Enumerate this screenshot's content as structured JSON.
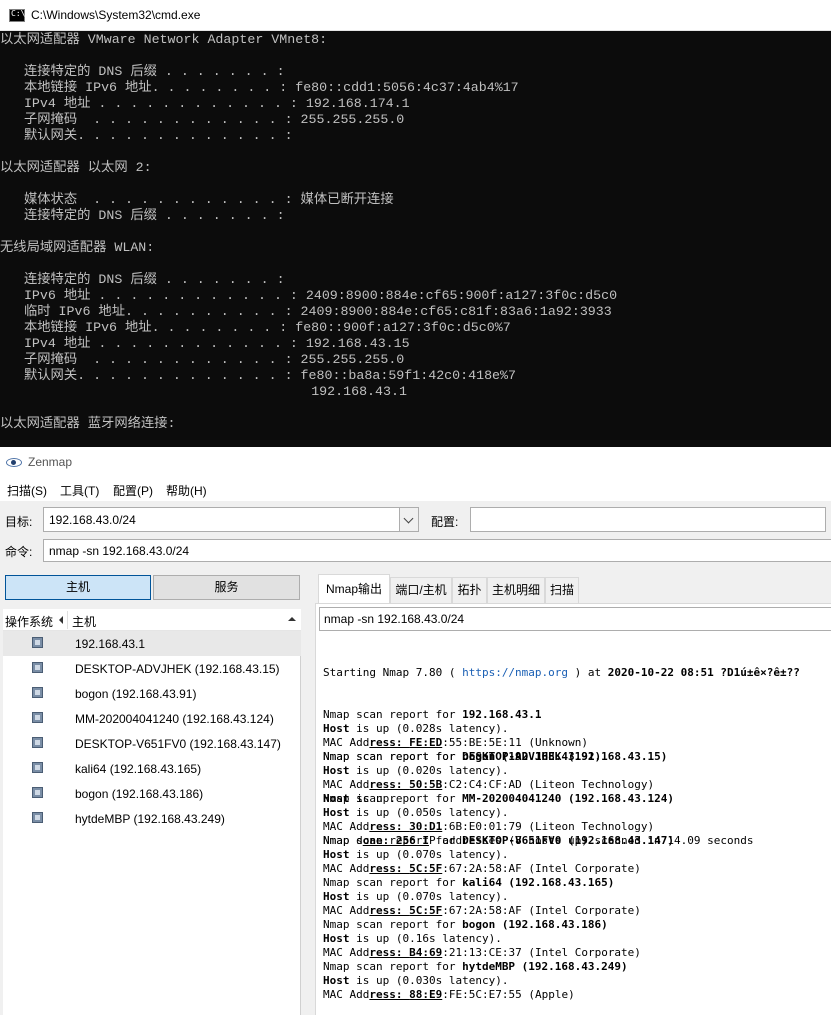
{
  "cmd": {
    "title": "C:\\Windows\\System32\\cmd.exe",
    "lines": [
      "以太网适配器 VMware Network Adapter VMnet8:",
      "",
      "   连接特定的 DNS 后缀 . . . . . . . :",
      "   本地链接 IPv6 地址. . . . . . . . : fe80::cdd1:5056:4c37:4ab4%17",
      "   IPv4 地址 . . . . . . . . . . . . : 192.168.174.1",
      "   子网掩码  . . . . . . . . . . . . : 255.255.255.0",
      "   默认网关. . . . . . . . . . . . . :",
      "",
      "以太网适配器 以太网 2:",
      "",
      "   媒体状态  . . . . . . . . . . . . : 媒体已断开连接",
      "   连接特定的 DNS 后缀 . . . . . . . :",
      "",
      "无线局域网适配器 WLAN:",
      "",
      "   连接特定的 DNS 后缀 . . . . . . . :",
      "   IPv6 地址 . . . . . . . . . . . . : 2409:8900:884e:cf65:900f:a127:3f0c:d5c0",
      "   临时 IPv6 地址. . . . . . . . . . : 2409:8900:884e:cf65:c81f:83a6:1a92:3933",
      "   本地链接 IPv6 地址. . . . . . . . : fe80::900f:a127:3f0c:d5c0%7",
      "   IPv4 地址 . . . . . . . . . . . . : 192.168.43.15",
      "   子网掩码  . . . . . . . . . . . . : 255.255.255.0",
      "   默认网关. . . . . . . . . . . . . : fe80::ba8a:59f1:42c0:418e%7",
      "                                       192.168.43.1",
      "",
      "以太网适配器 蓝牙网络连接:"
    ]
  },
  "zenmap": {
    "title": "Zenmap",
    "menu": [
      "扫描(S)",
      "工具(T)",
      "配置(P)",
      "帮助(H)"
    ],
    "target_label": "目标:",
    "target_value": "192.168.43.0/24",
    "profile_label": "配置:",
    "profile_value": "",
    "command_label": "命令:",
    "command_value": "nmap -sn 192.168.43.0/24",
    "left_buttons": {
      "hosts": "主机",
      "services": "服务"
    },
    "host_columns": {
      "os": "操作系统",
      "host": "主机"
    },
    "hosts": [
      "192.168.43.1",
      "DESKTOP-ADVJHEK (192.168.43.15)",
      "bogon (192.168.43.91)",
      "MM-202004041240 (192.168.43.124)",
      "DESKTOP-V651FV0 (192.168.43.147)",
      "kali64 (192.168.43.165)",
      "bogon (192.168.43.186)",
      "hytdeMBP (192.168.43.249)"
    ],
    "tabs": [
      "Nmap输出",
      "端口/主机",
      "拓扑",
      "主机明细",
      "扫描"
    ],
    "output_command": "nmap -sn 192.168.43.0/24",
    "output_start": {
      "prefix": "Starting Nmap 7.80 ( ",
      "url": "https://nmap.org",
      "suffix": " ) at ",
      "date": "2020-10-22 08:51 ?D1ú±ê×?ê±??"
    },
    "output_blocks": [
      {
        "host": "192.168.43.1",
        "latency": "(0.028s latency).",
        "mac_a": "FE:ED",
        "mac_b": ":55:BE:5E:11",
        "vendor": "(Unknown)"
      },
      {
        "host": "bogon (192.168.43.91)",
        "latency": "(0.020s latency).",
        "mac_a": "50:5B",
        "mac_b": ":C2:C4:CF:AD",
        "vendor": "(Liteon Technology)"
      },
      {
        "host": "MM-202004041240 (192.168.43.124)",
        "latency": "(0.050s latency).",
        "mac_a": "30:D1",
        "mac_b": ":6B:E0:01:79",
        "vendor": "(Liteon Technology)"
      },
      {
        "host": "DESKTOP-V651FV0 (192.168.43.147)",
        "latency": "(0.070s latency).",
        "mac_a": "5C:5F",
        "mac_b": ":67:2A:58:AF",
        "vendor": "(Intel Corporate)"
      },
      {
        "host": "kali64 (192.168.43.165)",
        "latency": "(0.070s latency).",
        "mac_a": "5C:5F",
        "mac_b": ":67:2A:58:AF",
        "vendor": "(Intel Corporate)"
      },
      {
        "host": "bogon (192.168.43.186)",
        "latency": "(0.16s latency).",
        "mac_a": "B4:69",
        "mac_b": ":21:13:CE:37",
        "vendor": "(Intel Corporate)"
      },
      {
        "host": "hytdeMBP (192.168.43.249)",
        "latency": "(0.030s latency).",
        "mac_a": "88:E9",
        "mac_b": ":FE:5C:E7:55",
        "vendor": "(Apple)"
      }
    ],
    "output_final": {
      "host": "DESKTOP-ADVJHEK (192.168.43.15)",
      "status": "Host is up."
    },
    "output_done": "Nmap done: 256 IP addresses (8 hosts up) scanned in 14.09 seconds"
  }
}
